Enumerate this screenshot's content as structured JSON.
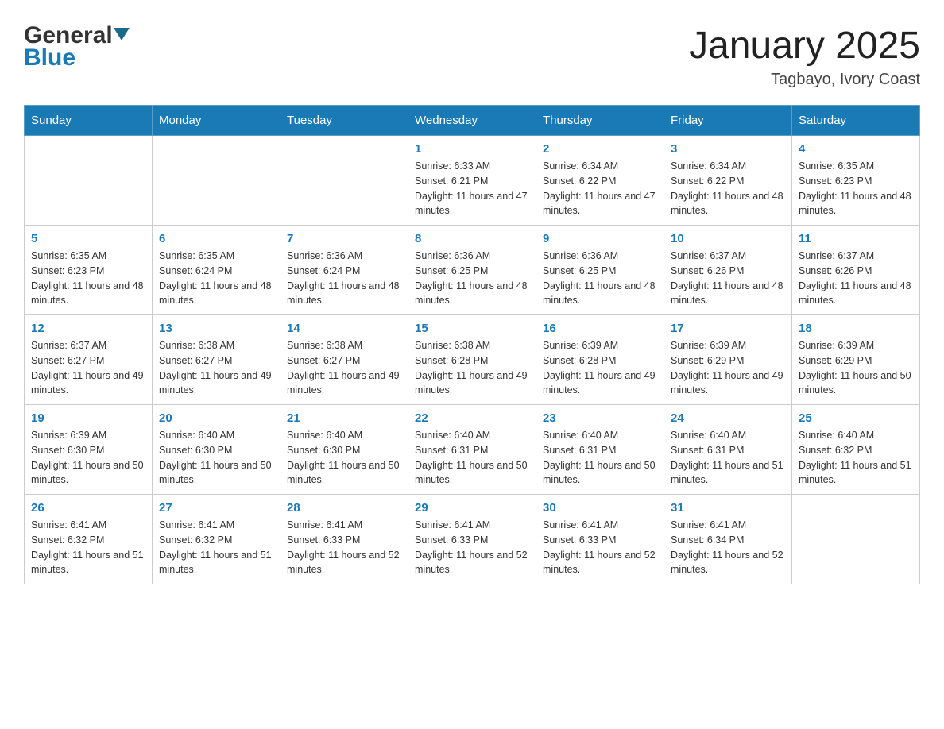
{
  "header": {
    "logo_general": "General",
    "logo_blue": "Blue",
    "month_title": "January 2025",
    "location": "Tagbayo, Ivory Coast"
  },
  "days_of_week": [
    "Sunday",
    "Monday",
    "Tuesday",
    "Wednesday",
    "Thursday",
    "Friday",
    "Saturday"
  ],
  "weeks": [
    [
      {
        "day": "",
        "sunrise": "",
        "sunset": "",
        "daylight": ""
      },
      {
        "day": "",
        "sunrise": "",
        "sunset": "",
        "daylight": ""
      },
      {
        "day": "",
        "sunrise": "",
        "sunset": "",
        "daylight": ""
      },
      {
        "day": "1",
        "sunrise": "Sunrise: 6:33 AM",
        "sunset": "Sunset: 6:21 PM",
        "daylight": "Daylight: 11 hours and 47 minutes."
      },
      {
        "day": "2",
        "sunrise": "Sunrise: 6:34 AM",
        "sunset": "Sunset: 6:22 PM",
        "daylight": "Daylight: 11 hours and 47 minutes."
      },
      {
        "day": "3",
        "sunrise": "Sunrise: 6:34 AM",
        "sunset": "Sunset: 6:22 PM",
        "daylight": "Daylight: 11 hours and 48 minutes."
      },
      {
        "day": "4",
        "sunrise": "Sunrise: 6:35 AM",
        "sunset": "Sunset: 6:23 PM",
        "daylight": "Daylight: 11 hours and 48 minutes."
      }
    ],
    [
      {
        "day": "5",
        "sunrise": "Sunrise: 6:35 AM",
        "sunset": "Sunset: 6:23 PM",
        "daylight": "Daylight: 11 hours and 48 minutes."
      },
      {
        "day": "6",
        "sunrise": "Sunrise: 6:35 AM",
        "sunset": "Sunset: 6:24 PM",
        "daylight": "Daylight: 11 hours and 48 minutes."
      },
      {
        "day": "7",
        "sunrise": "Sunrise: 6:36 AM",
        "sunset": "Sunset: 6:24 PM",
        "daylight": "Daylight: 11 hours and 48 minutes."
      },
      {
        "day": "8",
        "sunrise": "Sunrise: 6:36 AM",
        "sunset": "Sunset: 6:25 PM",
        "daylight": "Daylight: 11 hours and 48 minutes."
      },
      {
        "day": "9",
        "sunrise": "Sunrise: 6:36 AM",
        "sunset": "Sunset: 6:25 PM",
        "daylight": "Daylight: 11 hours and 48 minutes."
      },
      {
        "day": "10",
        "sunrise": "Sunrise: 6:37 AM",
        "sunset": "Sunset: 6:26 PM",
        "daylight": "Daylight: 11 hours and 48 minutes."
      },
      {
        "day": "11",
        "sunrise": "Sunrise: 6:37 AM",
        "sunset": "Sunset: 6:26 PM",
        "daylight": "Daylight: 11 hours and 48 minutes."
      }
    ],
    [
      {
        "day": "12",
        "sunrise": "Sunrise: 6:37 AM",
        "sunset": "Sunset: 6:27 PM",
        "daylight": "Daylight: 11 hours and 49 minutes."
      },
      {
        "day": "13",
        "sunrise": "Sunrise: 6:38 AM",
        "sunset": "Sunset: 6:27 PM",
        "daylight": "Daylight: 11 hours and 49 minutes."
      },
      {
        "day": "14",
        "sunrise": "Sunrise: 6:38 AM",
        "sunset": "Sunset: 6:27 PM",
        "daylight": "Daylight: 11 hours and 49 minutes."
      },
      {
        "day": "15",
        "sunrise": "Sunrise: 6:38 AM",
        "sunset": "Sunset: 6:28 PM",
        "daylight": "Daylight: 11 hours and 49 minutes."
      },
      {
        "day": "16",
        "sunrise": "Sunrise: 6:39 AM",
        "sunset": "Sunset: 6:28 PM",
        "daylight": "Daylight: 11 hours and 49 minutes."
      },
      {
        "day": "17",
        "sunrise": "Sunrise: 6:39 AM",
        "sunset": "Sunset: 6:29 PM",
        "daylight": "Daylight: 11 hours and 49 minutes."
      },
      {
        "day": "18",
        "sunrise": "Sunrise: 6:39 AM",
        "sunset": "Sunset: 6:29 PM",
        "daylight": "Daylight: 11 hours and 50 minutes."
      }
    ],
    [
      {
        "day": "19",
        "sunrise": "Sunrise: 6:39 AM",
        "sunset": "Sunset: 6:30 PM",
        "daylight": "Daylight: 11 hours and 50 minutes."
      },
      {
        "day": "20",
        "sunrise": "Sunrise: 6:40 AM",
        "sunset": "Sunset: 6:30 PM",
        "daylight": "Daylight: 11 hours and 50 minutes."
      },
      {
        "day": "21",
        "sunrise": "Sunrise: 6:40 AM",
        "sunset": "Sunset: 6:30 PM",
        "daylight": "Daylight: 11 hours and 50 minutes."
      },
      {
        "day": "22",
        "sunrise": "Sunrise: 6:40 AM",
        "sunset": "Sunset: 6:31 PM",
        "daylight": "Daylight: 11 hours and 50 minutes."
      },
      {
        "day": "23",
        "sunrise": "Sunrise: 6:40 AM",
        "sunset": "Sunset: 6:31 PM",
        "daylight": "Daylight: 11 hours and 50 minutes."
      },
      {
        "day": "24",
        "sunrise": "Sunrise: 6:40 AM",
        "sunset": "Sunset: 6:31 PM",
        "daylight": "Daylight: 11 hours and 51 minutes."
      },
      {
        "day": "25",
        "sunrise": "Sunrise: 6:40 AM",
        "sunset": "Sunset: 6:32 PM",
        "daylight": "Daylight: 11 hours and 51 minutes."
      }
    ],
    [
      {
        "day": "26",
        "sunrise": "Sunrise: 6:41 AM",
        "sunset": "Sunset: 6:32 PM",
        "daylight": "Daylight: 11 hours and 51 minutes."
      },
      {
        "day": "27",
        "sunrise": "Sunrise: 6:41 AM",
        "sunset": "Sunset: 6:32 PM",
        "daylight": "Daylight: 11 hours and 51 minutes."
      },
      {
        "day": "28",
        "sunrise": "Sunrise: 6:41 AM",
        "sunset": "Sunset: 6:33 PM",
        "daylight": "Daylight: 11 hours and 52 minutes."
      },
      {
        "day": "29",
        "sunrise": "Sunrise: 6:41 AM",
        "sunset": "Sunset: 6:33 PM",
        "daylight": "Daylight: 11 hours and 52 minutes."
      },
      {
        "day": "30",
        "sunrise": "Sunrise: 6:41 AM",
        "sunset": "Sunset: 6:33 PM",
        "daylight": "Daylight: 11 hours and 52 minutes."
      },
      {
        "day": "31",
        "sunrise": "Sunrise: 6:41 AM",
        "sunset": "Sunset: 6:34 PM",
        "daylight": "Daylight: 11 hours and 52 minutes."
      },
      {
        "day": "",
        "sunrise": "",
        "sunset": "",
        "daylight": ""
      }
    ]
  ]
}
